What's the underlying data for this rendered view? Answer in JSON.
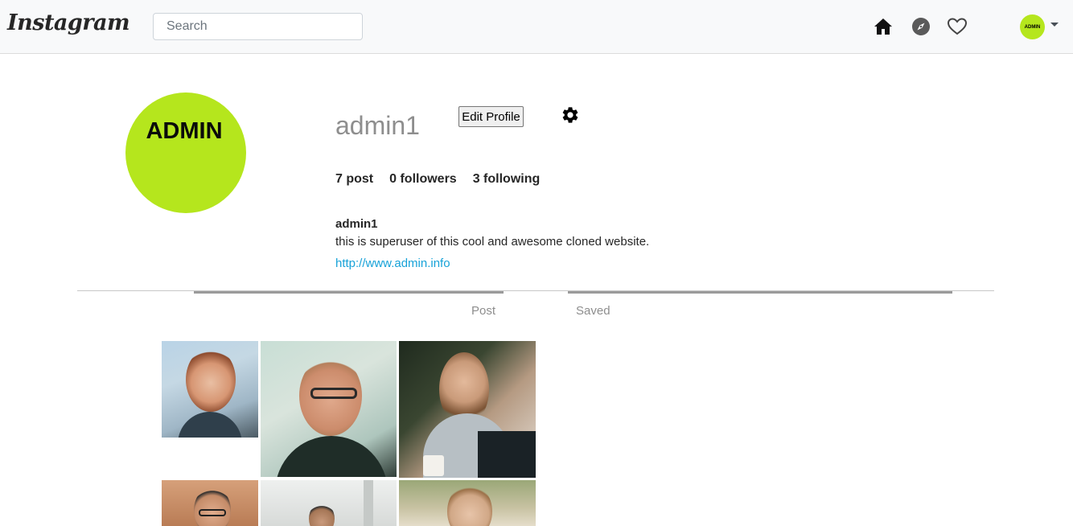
{
  "navbar": {
    "logo": "Instagram",
    "search_placeholder": "Search",
    "icons": [
      "home-icon",
      "explore-compass-icon",
      "heart-icon"
    ],
    "avatar_label": "ADMIN"
  },
  "profile": {
    "avatar_text": "ADMIN",
    "avatar_color": "#b5e61d",
    "username": "admin1",
    "edit_button": "Edit Profile",
    "stats": {
      "posts": "7 post",
      "followers": "0 followers",
      "following": "3 following"
    },
    "bio_name": "admin1",
    "bio_text": "this is superuser of this cool and awesome cloned website.",
    "website": "http://www.admin.info",
    "link_color": "#17a2d8"
  },
  "tabs": [
    {
      "label": "Post"
    },
    {
      "label": "Saved"
    }
  ],
  "posts": [
    {
      "subject": "woman with red bob haircut"
    },
    {
      "subject": "smiling man with glasses"
    },
    {
      "subject": "woman with laptop and cup"
    },
    {
      "subject": "man with glasses"
    },
    {
      "subject": "man in cap outdoors"
    },
    {
      "subject": "woman outdoors"
    }
  ]
}
